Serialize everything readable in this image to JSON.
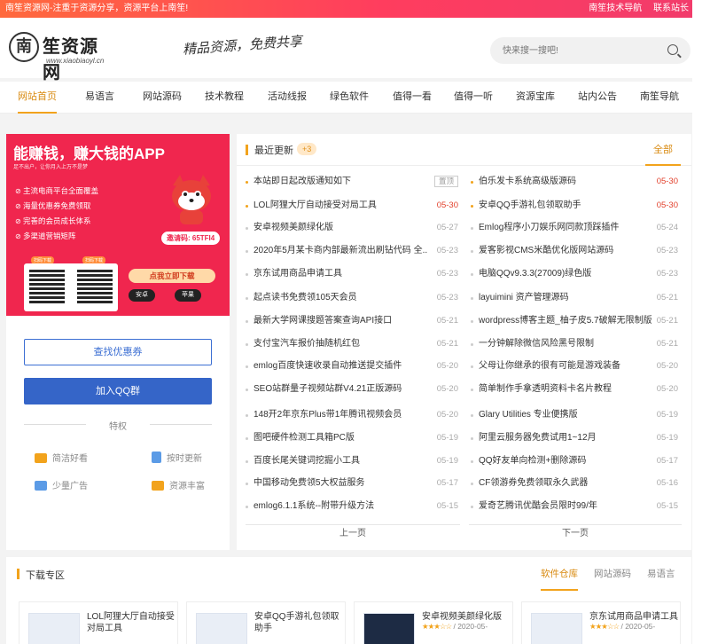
{
  "topbar": {
    "left": "南笙资源网-注重于资源分享，资源平台上南笙!",
    "links": [
      "南笙技术导航",
      "联系站长"
    ]
  },
  "header": {
    "logo_char": "南",
    "logo_name": "笙资源网",
    "logo_url": "www.xiaobiaoyl.cn",
    "slogan": "精品资源，免费共享",
    "search_placeholder": "快来搜一搜吧!"
  },
  "nav": [
    "网站首页",
    "易语言",
    "网站源码",
    "技术教程",
    "活动线报",
    "绿色软件",
    "值得一看",
    "值得一听",
    "资源宝库",
    "站内公告",
    "南笙导航"
  ],
  "promo": {
    "title": "能赚钱，赚大钱的APP",
    "subtitle": "足不出户，让你月入上万不是梦",
    "features": [
      "主流电商平台全面覆盖",
      "海量优惠券免费领取",
      "完善的会员成长体系",
      "多渠道营销矩阵"
    ],
    "invite_code": "邀请码: 65TFI4",
    "download": "点我立即下载",
    "qr_labels": [
      "扫码下载",
      "扫码下载"
    ],
    "os": [
      "安卓",
      "苹果"
    ]
  },
  "leftpanel": {
    "coupon_button": "查找优惠券",
    "qq_button": "加入QQ群",
    "perk_title": "特权",
    "perks": [
      "简洁好看",
      "按时更新",
      "少量广告",
      "资源丰富"
    ]
  },
  "latest": {
    "title": "最近更新",
    "badge": "+3",
    "all": "全部",
    "pin_tag": "置顶",
    "left_items": [
      {
        "title": "本站即日起改版通知如下",
        "date": ""
      },
      {
        "title": "LOL阿狸大厅自动接受对局工具",
        "date": "05-30"
      },
      {
        "title": "安卓视频美颜绿化版",
        "date": "05-27"
      },
      {
        "title": "2020年5月某卡商内部最新流出刷钻代码 全...",
        "date": "05-23"
      },
      {
        "title": "京东试用商品申请工具",
        "date": "05-23"
      },
      {
        "title": "起点读书免费领105天会员",
        "date": "05-23"
      },
      {
        "title": "最新大学网课搜题答案查询API接口",
        "date": "05-21"
      },
      {
        "title": "支付宝汽车报价抽随机红包",
        "date": "05-21"
      },
      {
        "title": "emlog百度快速收录自动推送提交插件",
        "date": "05-20"
      },
      {
        "title": "SEO站群量子视频站群V4.21正版源码",
        "date": "05-20"
      },
      {
        "title": "148开2年京东Plus带1年腾讯视频会员",
        "date": "05-20"
      },
      {
        "title": "图吧硬件检测工具箱PC版",
        "date": "05-19"
      },
      {
        "title": "百度长尾关键词挖掘小工具",
        "date": "05-19"
      },
      {
        "title": "中国移动免费领5大权益服务",
        "date": "05-17"
      },
      {
        "title": "emlog6.1.1系统--附带升级方法",
        "date": "05-15"
      }
    ],
    "right_items": [
      {
        "title": "伯乐发卡系统高级版源码",
        "date": "05-30"
      },
      {
        "title": "安卓QQ手游礼包领取助手",
        "date": "05-30"
      },
      {
        "title": "Emlog程序小刀娱乐网同款顶踩插件",
        "date": "05-24"
      },
      {
        "title": "爱客影视CMS米酷优化版网站源码",
        "date": "05-23"
      },
      {
        "title": "电脑QQv9.3.3(27009)绿色版",
        "date": "05-23"
      },
      {
        "title": "layuimini 资产管理源码",
        "date": "05-21"
      },
      {
        "title": "wordpress博客主题_柚子皮5.7破解无限制版",
        "date": "05-21"
      },
      {
        "title": "一分钟解除微信风险黑号限制",
        "date": "05-21"
      },
      {
        "title": "父母让你继承的很有可能是游戏装备",
        "date": "05-20"
      },
      {
        "title": "简单制作手拿透明资料卡名片教程",
        "date": "05-20"
      },
      {
        "title": "Glary Utilities 专业便携版",
        "date": "05-19"
      },
      {
        "title": "阿里云服务器免费试用1~12月",
        "date": "05-19"
      },
      {
        "title": "QQ好友单向检测+删除源码",
        "date": "05-17"
      },
      {
        "title": "CF领游券免费领取永久武器",
        "date": "05-16"
      },
      {
        "title": "爱奇艺腾讯优酷会员限时99/年",
        "date": "05-15"
      }
    ],
    "prev": "上一页",
    "next": "下一页"
  },
  "download": {
    "title": "下载专区",
    "tabs": [
      "软件仓库",
      "网站源码",
      "易语言"
    ],
    "cards": [
      {
        "title": "LOL阿狸大厅自动接受对局工具",
        "meta": ""
      },
      {
        "title": "安卓QQ手游礼包领取助手",
        "meta": ""
      },
      {
        "title": "安卓视频美颜绿化版",
        "meta": "/ 2020-05-"
      },
      {
        "title": "京东试用商品申请工具",
        "meta": "/ 2020-05-"
      }
    ]
  },
  "colors": {
    "accent": "#f2a31c",
    "brand_red": "#f0264e",
    "blue": "#3565c8"
  }
}
